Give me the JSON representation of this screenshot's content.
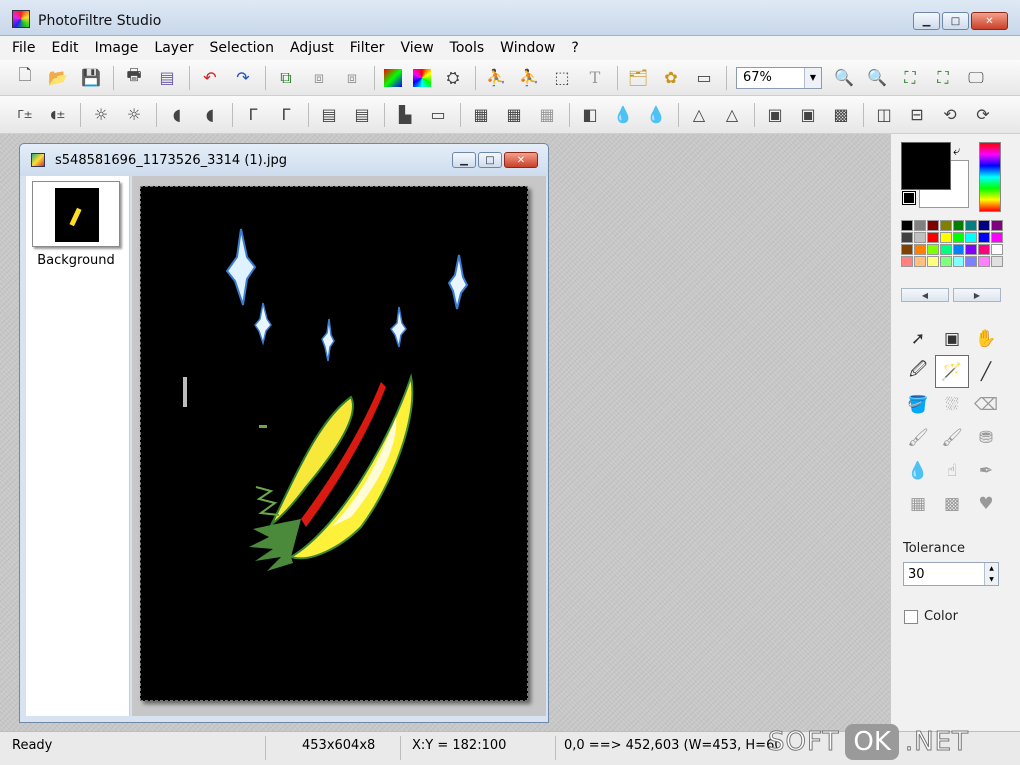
{
  "window": {
    "title": "PhotoFiltre Studio"
  },
  "menu": [
    "File",
    "Edit",
    "Image",
    "Layer",
    "Selection",
    "Adjust",
    "Filter",
    "View",
    "Tools",
    "Window",
    "?"
  ],
  "toolbar": {
    "zoom_value": "67%"
  },
  "document": {
    "title": "s548581696_1173526_3314 (1).jpg",
    "layer_name": "Background"
  },
  "tool_panel": {
    "tolerance_label": "Tolerance",
    "tolerance_value": "30",
    "color_label": "Color"
  },
  "status": {
    "ready": "Ready",
    "image_size": "453x604x8",
    "cursor_position": "X:Y = 182:100",
    "selection": "0,0 ==> 452,603 (W=453, H=60"
  },
  "watermark": {
    "left": "SOFT",
    "box": "OK",
    "right": ".NET"
  },
  "colors": {
    "foreground": "#000000",
    "background": "#ffffff",
    "palette": [
      "#000000",
      "#808080",
      "#800000",
      "#808000",
      "#008000",
      "#008080",
      "#000080",
      "#800080",
      "#404040",
      "#c0c0c0",
      "#ff0000",
      "#ffff00",
      "#00ff00",
      "#00ffff",
      "#0000ff",
      "#ff00ff",
      "#804000",
      "#ff8000",
      "#80ff00",
      "#00ff80",
      "#0080ff",
      "#8000ff",
      "#ff0080",
      "#ffffff",
      "#ff8080",
      "#ffc080",
      "#ffff80",
      "#80ff80",
      "#80ffff",
      "#8080ff",
      "#ff80ff",
      "#e0e0e0"
    ]
  }
}
